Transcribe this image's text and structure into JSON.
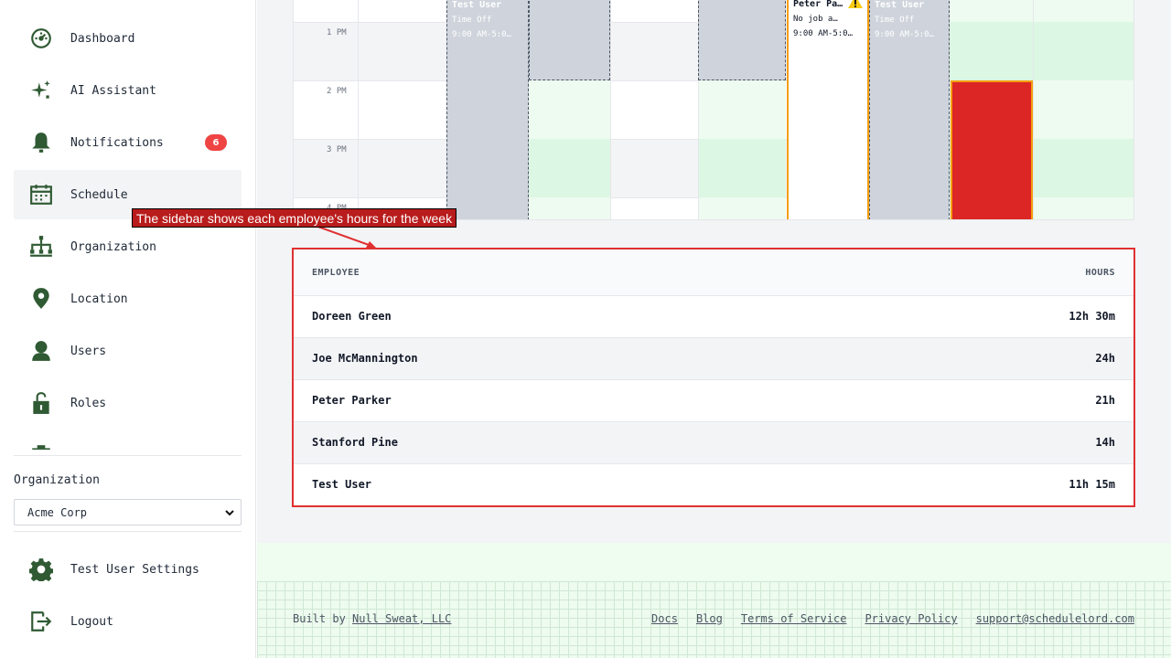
{
  "sidebar": {
    "items": [
      {
        "label": "Dashboard",
        "icon": "dashboard-icon"
      },
      {
        "label": "AI Assistant",
        "icon": "sparkle-icon"
      },
      {
        "label": "Notifications",
        "icon": "bell-icon",
        "badge": "6"
      },
      {
        "label": "Schedule",
        "icon": "calendar-icon",
        "active": true
      },
      {
        "label": "Organization",
        "icon": "org-chart-icon"
      },
      {
        "label": "Location",
        "icon": "map-pin-icon"
      },
      {
        "label": "Users",
        "icon": "user-icon"
      },
      {
        "label": "Roles",
        "icon": "unlock-icon"
      }
    ],
    "organization_label": "Organization",
    "organization_value": "Acme Corp",
    "settings_label": "Test User Settings",
    "logout_label": "Logout"
  },
  "calendar": {
    "time_labels": [
      "1 PM",
      "2 PM",
      "3 PM",
      "4 PM"
    ],
    "shifts": [
      {
        "name": "Test User",
        "detail": "Time Off",
        "time": "9:00 AM-5:0…"
      },
      {
        "name": "Peter Pa…",
        "detail": "No job a…",
        "time": "9:00 AM-5:0…",
        "warning": true
      },
      {
        "name": "Test User",
        "detail": "Time Off",
        "time": "9:00 AM-5:0…"
      }
    ]
  },
  "annotation": {
    "text": "The sidebar shows each employee's hours for the week"
  },
  "hours_table": {
    "headers": {
      "employee": "EMPLOYEE",
      "hours": "HOURS"
    },
    "rows": [
      {
        "name": "Doreen Green",
        "hours": "12h 30m"
      },
      {
        "name": "Joe McMannington",
        "hours": "24h"
      },
      {
        "name": "Peter Parker",
        "hours": "21h"
      },
      {
        "name": "Stanford Pine",
        "hours": "14h"
      },
      {
        "name": "Test User",
        "hours": "11h 15m"
      }
    ]
  },
  "footer": {
    "built_by_prefix": "Built by",
    "built_by_link": "Null Sweat, LLC",
    "links": [
      "Docs",
      "Blog",
      "Terms of Service",
      "Privacy Policy",
      "support@schedulelord.com"
    ]
  },
  "colors": {
    "brand_green": "#2f5a33",
    "badge_red": "#ef4444",
    "highlight_red": "#e03131",
    "shift_red": "#dc2626",
    "time_off_gray": "#cfd4dc",
    "warning_orange": "#f59e0b"
  }
}
